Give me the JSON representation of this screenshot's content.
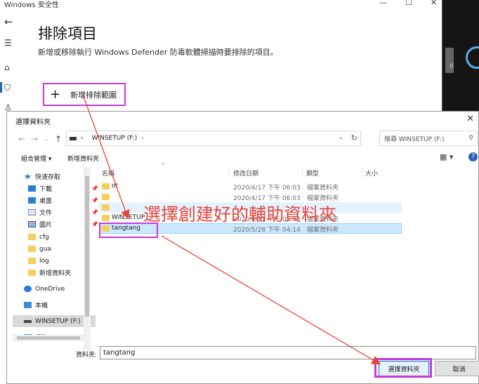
{
  "background": {
    "app_title": "Windows 安全性",
    "heading": "排除項目",
    "description": "新增或移除執行 Windows Defender 防毒軟體掃描時要排除的項目。",
    "add_exclusion": "新增排除範圍",
    "dark_panel_text": "0"
  },
  "dialog": {
    "title": "選擇資料夾",
    "address": {
      "computer": "WINSETUP (F:)"
    },
    "search_placeholder": "搜尋 WINSETUP (F:)",
    "toolbar": {
      "organize": "組合管理 ▾",
      "new_folder": "新增資料夾"
    },
    "columns": [
      "名稱",
      "修改日期",
      "類型",
      "大小"
    ],
    "files": [
      {
        "name": "ot",
        "date": "2020/4/17 下午 06:03",
        "type": "檔案資料夾"
      },
      {
        "name": "",
        "date": "2020/4/17 下午 06:03",
        "type": "檔案資料夾"
      },
      {
        "name": "",
        "date": "",
        "type": ""
      },
      {
        "name": "WINSETUP",
        "date": "2020/4/17 下午 06:08",
        "type": "檔案資料夾"
      },
      {
        "name": "tangtang",
        "date": "2020/5/28 下午 04:14",
        "type": "檔案資料夾",
        "selected": true
      }
    ],
    "nav_items": [
      {
        "label": "快速存取",
        "icon": "star-icon"
      },
      {
        "label": "下載",
        "icon": "download-icon",
        "pinned": true
      },
      {
        "label": "桌面",
        "icon": "desktop-icon",
        "pinned": true
      },
      {
        "label": "文件",
        "icon": "document-icon",
        "pinned": true
      },
      {
        "label": "圖片",
        "icon": "picture-icon",
        "pinned": true
      },
      {
        "label": "cfg",
        "icon": "folder-icon"
      },
      {
        "label": "gua",
        "icon": "folder-icon"
      },
      {
        "label": "log",
        "icon": "folder-icon"
      },
      {
        "label": "新增資料夾",
        "icon": "folder-icon"
      },
      {
        "label": "OneDrive",
        "icon": "cloud-icon"
      },
      {
        "label": "本機",
        "icon": "computer-icon"
      },
      {
        "label": "WINSETUP (F:)",
        "icon": "drive-icon",
        "selected": true
      },
      {
        "label": "網路",
        "icon": "network-icon"
      }
    ],
    "folder_label": "資料夾:",
    "folder_value": "tangtang",
    "select_button": "選擇資料夾",
    "cancel_button": "取消"
  },
  "annotation": "選擇創建好的輔助資料夾",
  "colors": {
    "highlight_box": "#c63ad6",
    "arrow": "#e8453c",
    "selection": "#cce8ff",
    "folder": "#f5cf5e"
  }
}
